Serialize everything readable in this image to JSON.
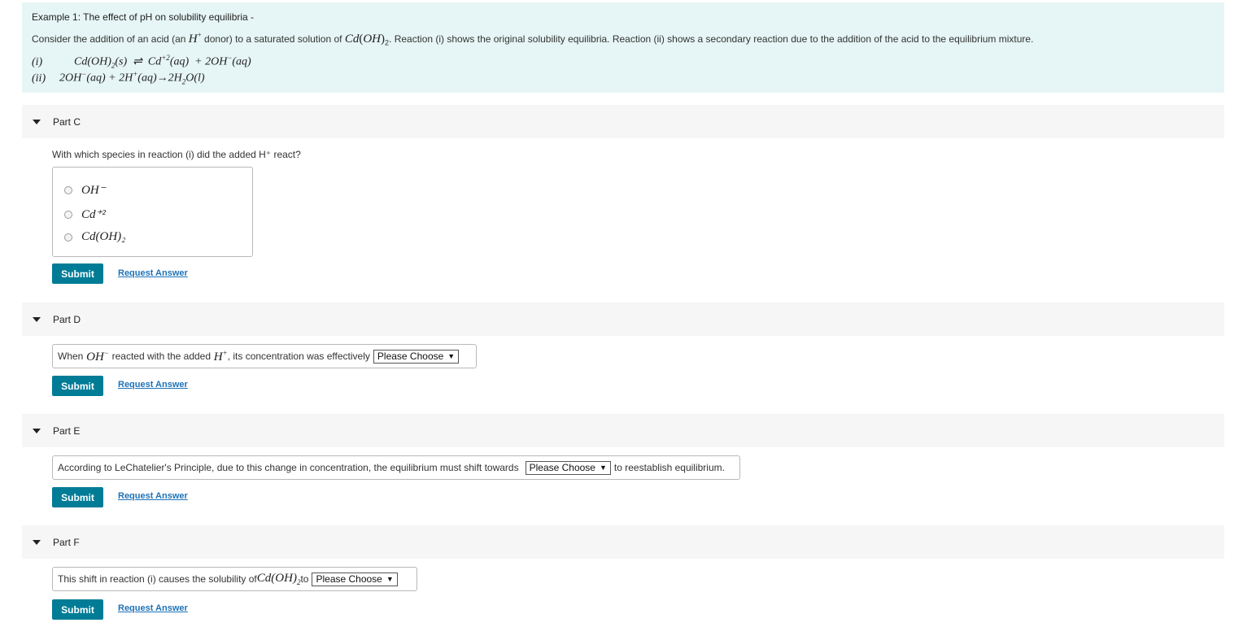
{
  "example": {
    "title": "Example 1: The effect of pH on solubility equilibria -",
    "desc_part1": "Consider the addition of an acid (an ",
    "desc_part2": " donor) to a saturated solution of ",
    "desc_part3": ". Reaction (i) shows the original solubility equilibria. Reaction (ii) shows a secondary reaction due to the addition of the acid to the equilibrium mixture.",
    "reaction1_num": "(i)",
    "reaction2_num": "(ii)"
  },
  "parts": {
    "c": {
      "title": "Part C",
      "question": "With which species in reaction (i) did the added H⁺ react?",
      "choices": [
        "OH⁻",
        "Cd⁺²",
        "Cd(OH)₂"
      ],
      "submit": "Submit",
      "request": "Request Answer"
    },
    "d": {
      "title": "Part D",
      "text_before": "When ",
      "text_middle": " reacted with the added ",
      "text_after": ", its concentration was effectively",
      "select": "Please Choose",
      "submit": "Submit",
      "request": "Request Answer"
    },
    "e": {
      "title": "Part E",
      "text_before": "According to LeChatelier's Principle, due to this change in concentration, the equilibrium must shift towards",
      "select": "Please Choose",
      "text_after": "to reestablish equilibrium.",
      "submit": "Submit",
      "request": "Request Answer"
    },
    "f": {
      "title": "Part F",
      "text_before": "This shift in reaction (i) causes the solubility of ",
      "text_middle": " to",
      "select": "Please Choose",
      "submit": "Submit",
      "request": "Request Answer"
    }
  },
  "colors": {
    "example_bg": "#e6f5f5",
    "header_bg": "#f6f6f6",
    "submit_bg": "#007c97",
    "link": "#1d72b8"
  },
  "icons": {
    "caret": "caret-down-icon",
    "select_arrow": "dropdown-arrow-icon"
  }
}
